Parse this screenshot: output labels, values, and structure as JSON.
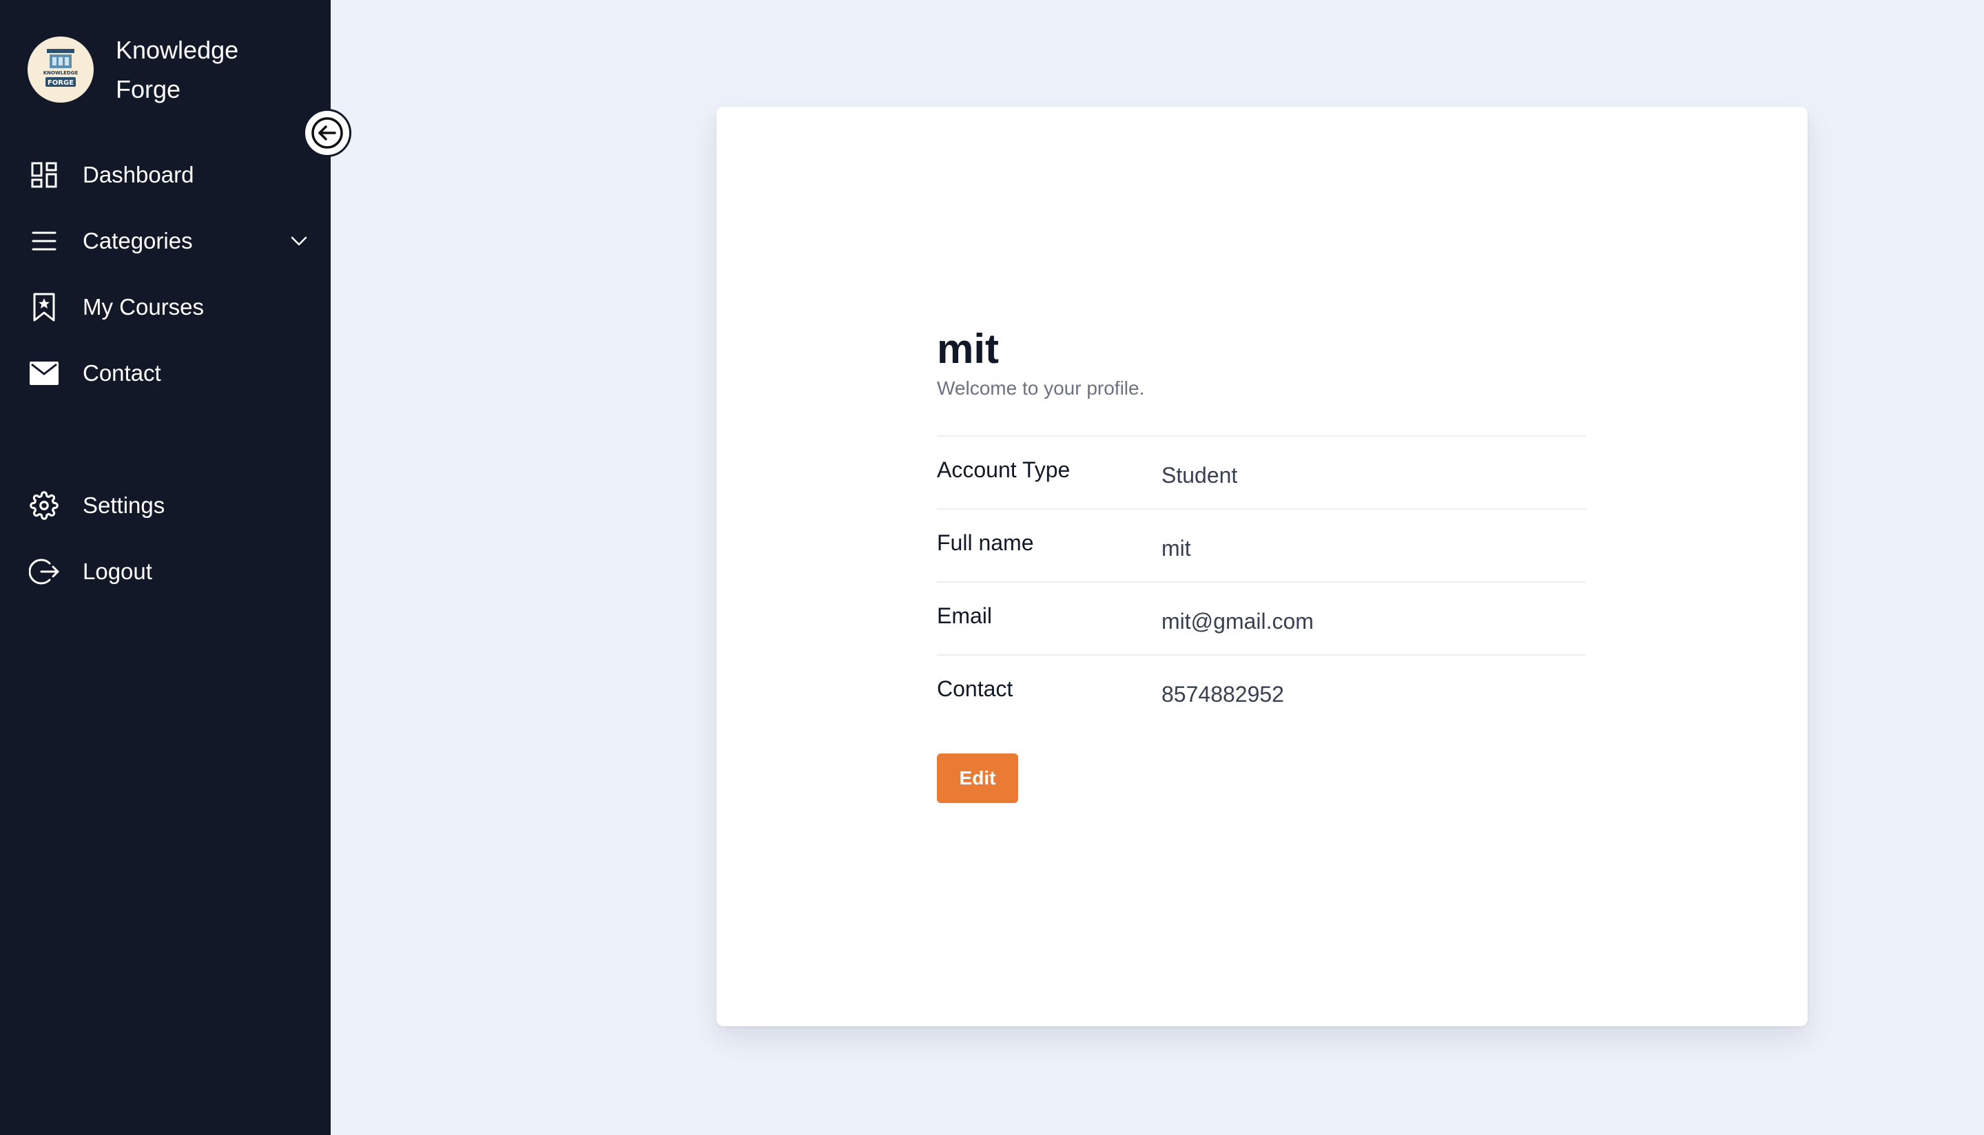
{
  "brand": {
    "name": "Knowledge Forge",
    "logo_text_top": "KNOWLEDGE",
    "logo_text_bottom": "FORGE"
  },
  "sidebar": {
    "items": [
      {
        "label": "Dashboard",
        "icon": "dashboard-icon"
      },
      {
        "label": "Categories",
        "icon": "menu-icon",
        "has_dropdown": true
      },
      {
        "label": "My Courses",
        "icon": "bookmark-icon"
      },
      {
        "label": "Contact",
        "icon": "mail-icon"
      },
      {
        "label": "Settings",
        "icon": "gear-icon"
      },
      {
        "label": "Logout",
        "icon": "logout-icon"
      }
    ]
  },
  "profile": {
    "name": "mit",
    "subtitle": "Welcome to your profile.",
    "fields": [
      {
        "label": "Account Type",
        "value": "Student"
      },
      {
        "label": "Full name",
        "value": "mit"
      },
      {
        "label": "Email",
        "value": "mit@gmail.com"
      },
      {
        "label": "Contact",
        "value": "8574882952"
      }
    ],
    "edit_label": "Edit"
  },
  "colors": {
    "sidebar_bg": "#121828",
    "page_bg": "#edf1f9",
    "accent": "#e97b35",
    "card_bg": "#ffffff"
  }
}
